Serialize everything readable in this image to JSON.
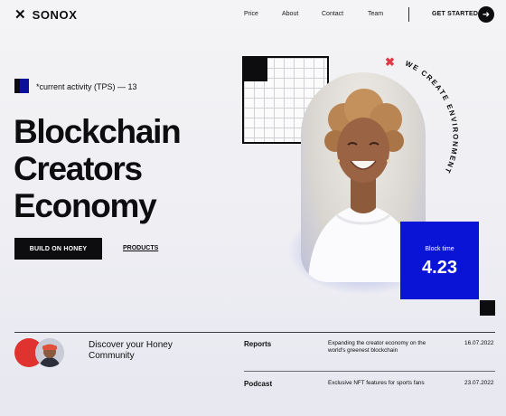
{
  "nav": {
    "logo_icon": "x-icon",
    "logo_text": "SONOX",
    "links": [
      "Price",
      "About",
      "Contact",
      "Team"
    ],
    "cta": "GET STARTED",
    "cta_icon": "arrow-right-icon"
  },
  "hero": {
    "tps_text": "*current activity (TPS) — 13",
    "headline": [
      "Blockchain",
      "Creators",
      "Economy"
    ],
    "primary_button": "BUILD ON HONEY",
    "secondary_link": "PRODUCTS",
    "circular_text": "WE CREATE ENVIRONMENT",
    "stat_label": "Block time",
    "stat_value": "4.23"
  },
  "community": {
    "title": "Discover your Honey Community"
  },
  "news": [
    {
      "title": "Reports",
      "description": "Expanding the creator economy on the world's greenest blockchain",
      "date": "16.07.2022"
    },
    {
      "title": "Podcast",
      "description": "Exclusive NFT features for sports fans",
      "date": "23.07.2022"
    }
  ],
  "colors": {
    "accent_blue": "#0a14d6",
    "accent_red": "#e0322f",
    "text_dark": "#0d0d0f",
    "background": "#f0f0f4"
  }
}
